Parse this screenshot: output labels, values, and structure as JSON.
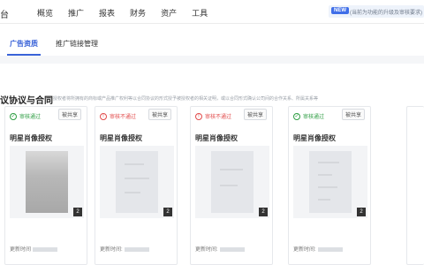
{
  "brand": "台",
  "nav": [
    "概览",
    "推广",
    "报表",
    "财务",
    "资产",
    "工具"
  ],
  "notice": {
    "badge": "NEW",
    "text": "(当前为功能的升级及审核要求)"
  },
  "tabs": {
    "active": "广告资质",
    "inactive": "推广链接管理"
  },
  "section": {
    "title": "议协议与合同",
    "desc": "授权者将所拥有的商标或产品推广权利等以合同协议的形式授予被授权者的相关证明，或以合同形式确认公司间的合作关系、所属关系等"
  },
  "cards": [
    {
      "status": "审核通过",
      "status_type": "approved",
      "shared": "被共享",
      "title": "明星肖像授权",
      "count": "2",
      "updated": "更新时间"
    },
    {
      "status": "审核不通过",
      "status_type": "rejected",
      "shared": "被共享",
      "title": "明星肖像授权",
      "count": "2",
      "updated": "更新时间:"
    },
    {
      "status": "审核不通过",
      "status_type": "rejected",
      "shared": "被共享",
      "title": "明星肖像授权",
      "count": "2",
      "updated": "更新时间:"
    },
    {
      "status": "审核通过",
      "status_type": "approved",
      "shared": "被共享",
      "title": "明星肖像授权",
      "count": "2",
      "updated": "更新时间:"
    }
  ],
  "colors": {
    "accent": "#3a63d8",
    "rejected": "#e24c4c",
    "approved": "#2f9e44"
  }
}
